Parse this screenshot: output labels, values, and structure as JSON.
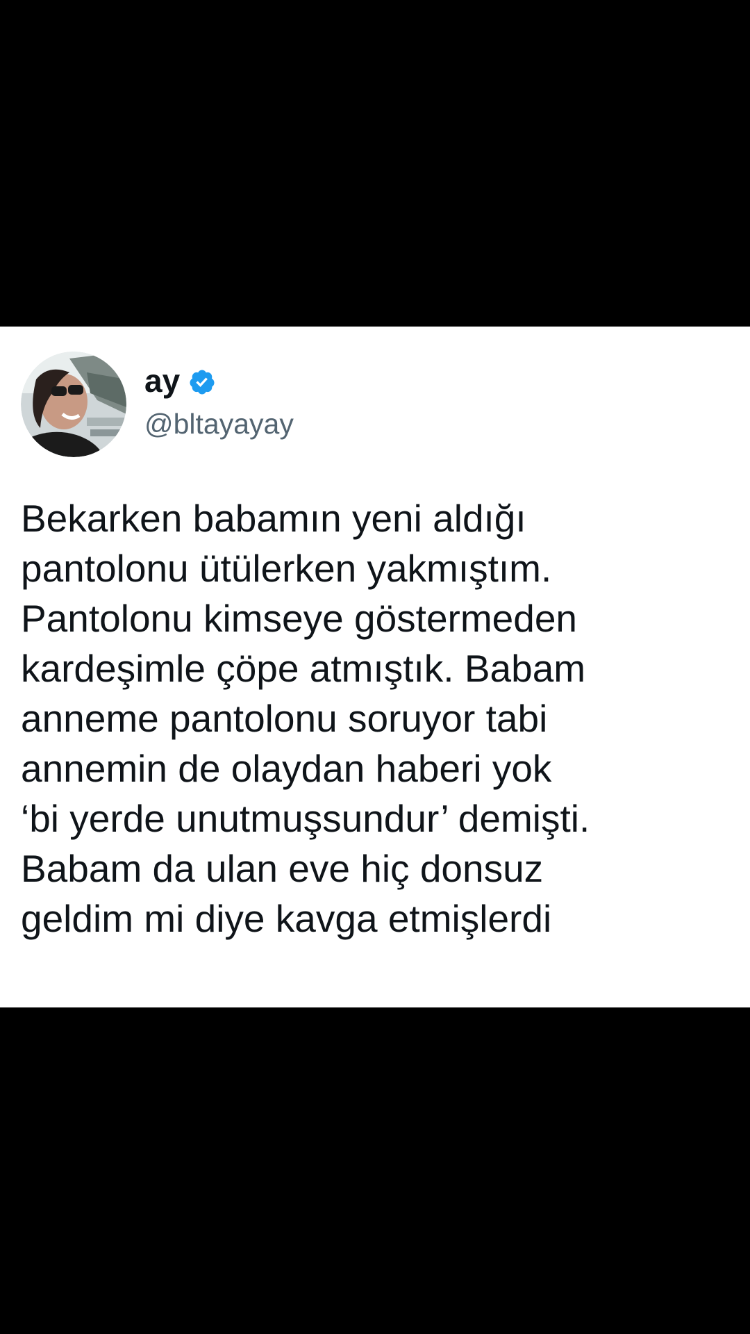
{
  "tweet": {
    "author": {
      "display_name": "ay",
      "handle": "@bltayayay",
      "verified_icon": "verified-badge-icon",
      "avatar_icon": "profile-photo"
    },
    "text_lines": [
      "Bekarken babamın yeni aldığı",
      "pantolonu ütülerken yakmıştım.",
      "Pantolonu kimseye göstermeden",
      "kardeşimle çöpe atmıştık. Babam",
      "anneme pantolonu soruyor tabi",
      "annemin de olaydan haberi yok",
      "‘bi yerde unutmuşsundur’ demişti.",
      "Babam da ulan eve hiç donsuz",
      "geldim mi diye kavga etmişlerdi"
    ]
  },
  "colors": {
    "background": "#000000",
    "card": "#ffffff",
    "text": "#0f1419",
    "secondary_text": "#536471",
    "verified": "#1d9bf0"
  }
}
